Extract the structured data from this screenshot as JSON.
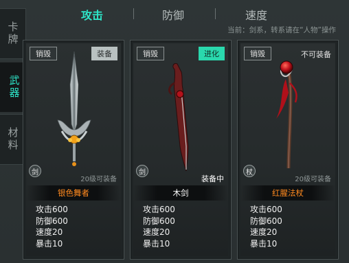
{
  "side_tabs": [
    "卡牌",
    "武器",
    "材料"
  ],
  "top_tabs": [
    "攻击",
    "防御",
    "速度"
  ],
  "hint": "当前：剑系，转系请在“人物”操作",
  "cards": [
    {
      "destroy": "销毁",
      "action": "装备",
      "type": "剑",
      "level": "20级可装备",
      "name": "银色舞者",
      "stats": [
        "攻击600",
        "防御600",
        "速度20",
        "暴击10"
      ]
    },
    {
      "destroy": "销毁",
      "action": "进化",
      "type": "剑",
      "status": "装备中",
      "name": "木剑",
      "stats": [
        "攻击600",
        "防御600",
        "速度20",
        "暴击10"
      ]
    },
    {
      "destroy": "销毁",
      "action": "不可装备",
      "type": "杖",
      "level": "20级可装备",
      "name": "红腥法杖",
      "stats": [
        "攻击600",
        "防御600",
        "速度20",
        "暴击10"
      ]
    }
  ],
  "colors": {
    "accent": "#2ee6c9",
    "evolve": "#2ad8ad",
    "rare_name": "#ff8a1f"
  }
}
